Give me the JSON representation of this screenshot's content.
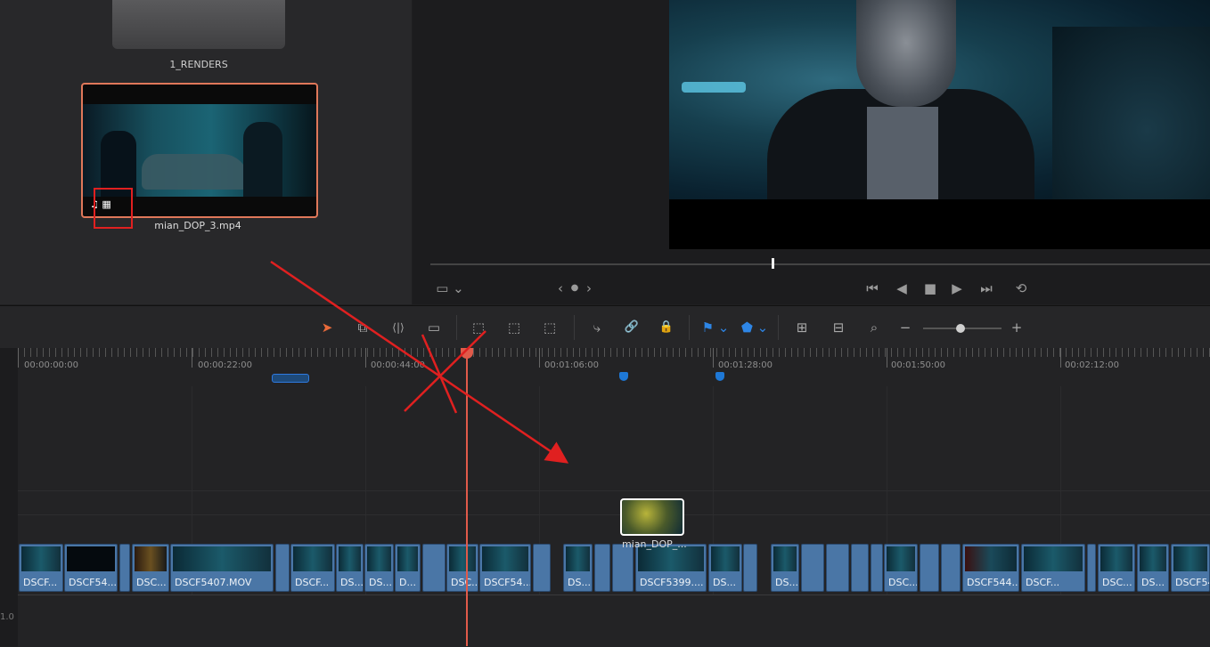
{
  "media_pool": {
    "folder_label": "1_RENDERS",
    "clip_name": "mian_DOP_3.mp4",
    "clip_icons": "♫ ▦"
  },
  "viewer": {
    "nav_prev": "‹",
    "nav_dot": "●",
    "nav_next": "›",
    "view_mode_icon": "▭ ⌄",
    "transport": {
      "first_frame": "⏮",
      "play_reverse": "◀",
      "stop": "■",
      "play": "▶",
      "last_frame": "⏭",
      "loop": "⟲"
    }
  },
  "toolbar": {
    "select_tool": "➤",
    "trim_tool": "⧉",
    "dynamic_trim": "⟨|⟩",
    "blade_tool": "▭",
    "insert_clip": "⬚",
    "overwrite_clip": "⬚",
    "replace_clip": "⬚",
    "snapping": "⤷",
    "linked_selection": "🔗",
    "position_lock": "🔒",
    "flag": "⚑ ⌄",
    "marker": "⬟ ⌄",
    "zoom_full": "⊞",
    "zoom_detail": "⊟",
    "zoom_custom": "⌕",
    "zoom_minus": "−",
    "zoom_plus": "+"
  },
  "ruler": {
    "timecodes": [
      "00:00:00:00",
      "00:00:22:00",
      "00:00:44:00",
      "00:01:06:00",
      "00:01:28:00",
      "00:01:50:00",
      "00:02:12:00"
    ]
  },
  "timeline": {
    "drag_clip_name": "mian_DOP_...",
    "track_number": "1.0",
    "clips": [
      "DSCF...",
      "DSCF54...",
      "DSC...",
      "DSCF5407.MOV",
      "DSCF...",
      "DS...",
      "DS...",
      "D...",
      "DSC...",
      "DSCF54...",
      "DS...",
      "DSCF5399....",
      "DS...",
      "DS...",
      "DSC...",
      "DSCF544...",
      "DSCF...",
      "DSC...",
      "DS...",
      "DSCF54"
    ]
  },
  "colors": {
    "playhead": "#e05a4a",
    "clip": "#4a76a6",
    "annotation": "#e02020",
    "marker": "#1e78d6"
  }
}
